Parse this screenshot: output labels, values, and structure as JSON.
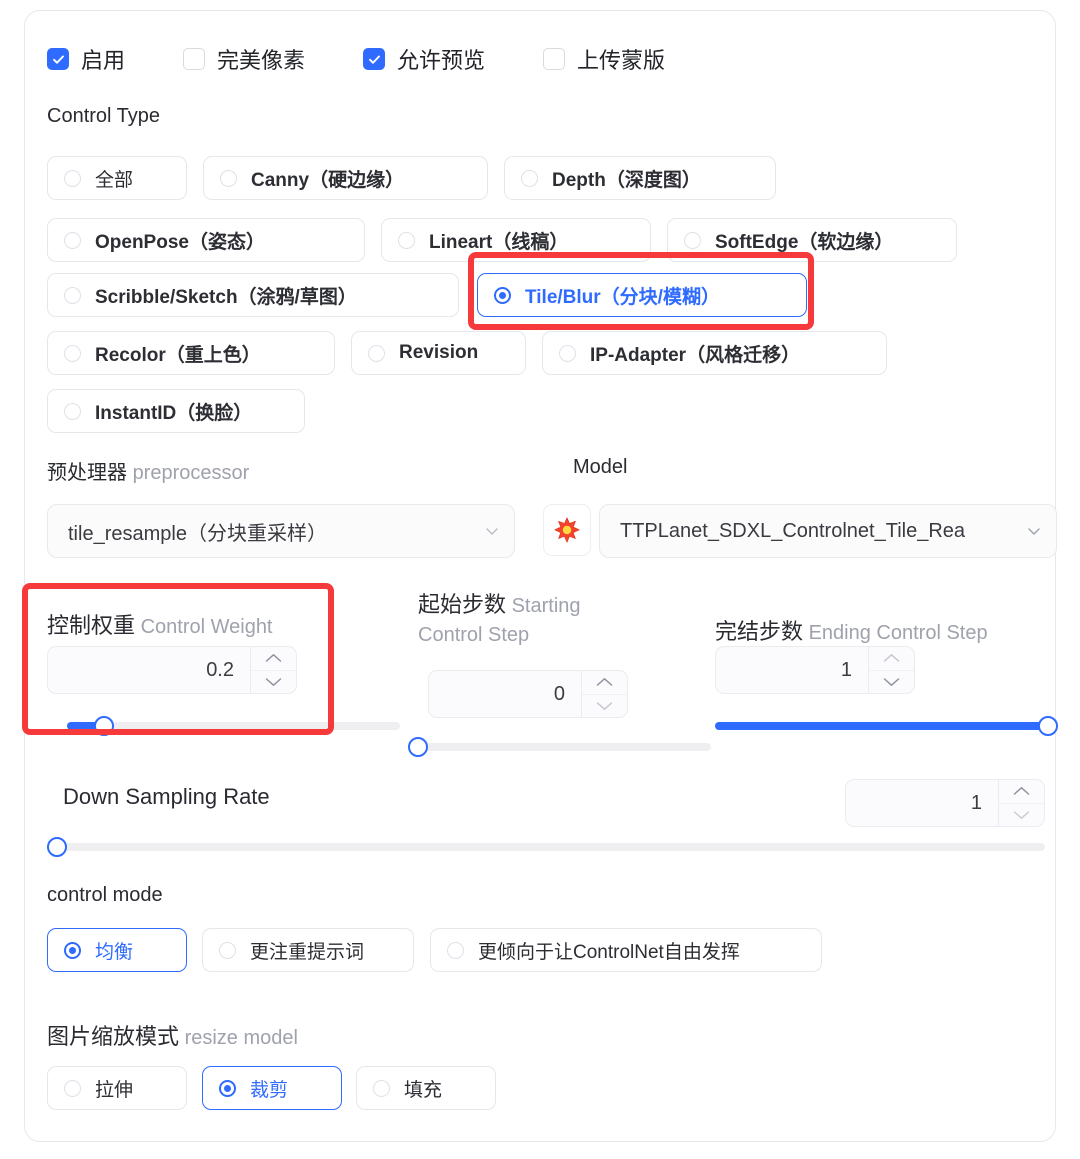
{
  "colors": {
    "accent": "#2f6bff",
    "annotation": "#f6393b",
    "text": "#2a2b31",
    "muted": "#9fa2ad",
    "border": "#e6e7ec"
  },
  "checkboxes": [
    {
      "label": "启用",
      "checked": true
    },
    {
      "label": "完美像素",
      "checked": false
    },
    {
      "label": "允许预览",
      "checked": true
    },
    {
      "label": "上传蒙版",
      "checked": false
    }
  ],
  "control_type": {
    "title": "Control Type",
    "options": [
      {
        "label": "全部",
        "selected": false,
        "cjk_only": true
      },
      {
        "label": "Canny（硬边缘）",
        "selected": false
      },
      {
        "label": "Depth（深度图）",
        "selected": false
      },
      {
        "label": "OpenPose（姿态）",
        "selected": false
      },
      {
        "label": "Lineart（线稿）",
        "selected": false
      },
      {
        "label": "SoftEdge（软边缘）",
        "selected": false
      },
      {
        "label": "Scribble/Sketch（涂鸦/草图）",
        "selected": false
      },
      {
        "label": "Tile/Blur（分块/模糊）",
        "selected": true
      },
      {
        "label": "Recolor（重上色）",
        "selected": false
      },
      {
        "label": "Revision",
        "selected": false
      },
      {
        "label": "IP-Adapter（风格迁移）",
        "selected": false
      },
      {
        "label": "InstantID（换脸）",
        "selected": false
      }
    ]
  },
  "preprocessor": {
    "label_cn": "预处理器",
    "label_en": "preprocessor",
    "value": "tile_resample（分块重采样）",
    "refresh_icon": "explosion-icon"
  },
  "model": {
    "label": "Model",
    "value": "TTPLanet_SDXL_Controlnet_Tile_Rea"
  },
  "control_weight": {
    "label_cn": "控制权重",
    "label_en": "Control Weight",
    "value": "0.2",
    "slider_percent": 11,
    "highlighted": true
  },
  "starting_step": {
    "label_cn": "起始步数",
    "label_en": "Starting Control Step",
    "value": "0",
    "slider_percent": 0
  },
  "ending_step": {
    "label_cn": "完结步数",
    "label_en": "Ending Control Step",
    "value": "1",
    "slider_percent": 100
  },
  "down_sampling_rate": {
    "label": "Down Sampling Rate",
    "value": "1",
    "slider_percent": 0
  },
  "control_mode": {
    "title": "control mode",
    "options": [
      {
        "label": "均衡",
        "selected": true
      },
      {
        "label": "更注重提示词",
        "selected": false
      },
      {
        "label": "更倾向于让ControlNet自由发挥",
        "selected": false
      }
    ]
  },
  "resize_model": {
    "title_cn": "图片缩放模式",
    "title_en": "resize model",
    "options": [
      {
        "label": "拉伸",
        "selected": false
      },
      {
        "label": "裁剪",
        "selected": true
      },
      {
        "label": "填充",
        "selected": false
      }
    ]
  }
}
